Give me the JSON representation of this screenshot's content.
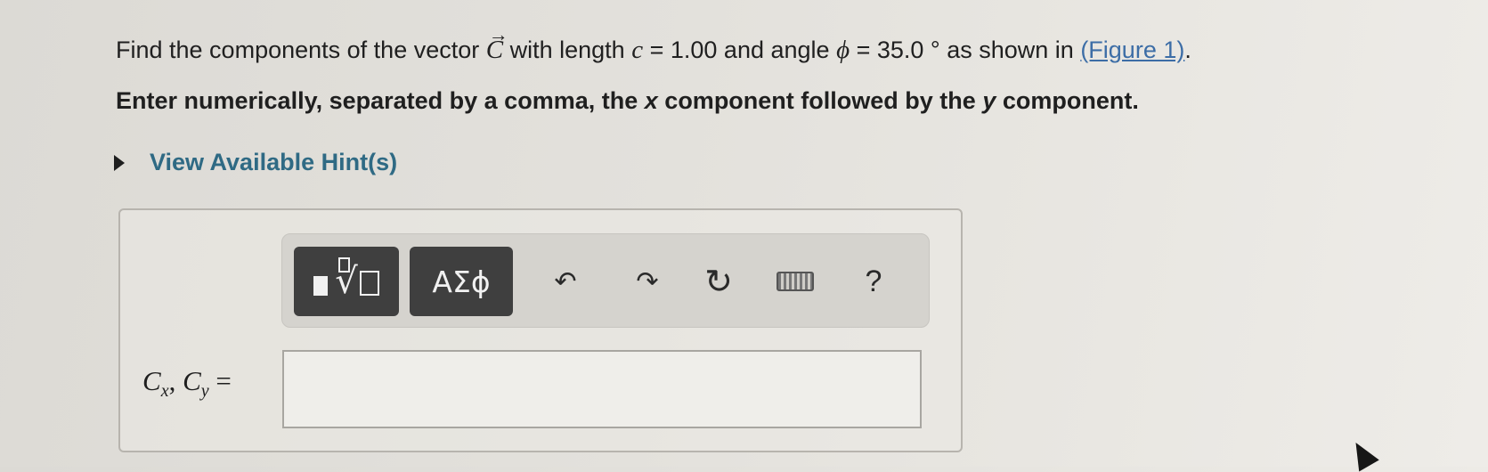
{
  "question": {
    "line1_prefix": "Find the components of the vector",
    "vector_symbol": "C",
    "vector_arrow": "→",
    "line1_mid": "with length",
    "length_var": "c",
    "length_value": "= 1.00 and angle",
    "angle_var": "ϕ",
    "angle_value": "= 35.0 °  as shown in",
    "figure_link": "(Figure 1)",
    "line1_end": ".",
    "line2_part1": "Enter numerically, separated by a comma, the",
    "line2_x": "x",
    "line2_part2": "component followed by the",
    "line2_y": "y",
    "line2_part3": "component."
  },
  "hint": {
    "label": "View Available Hint(s)"
  },
  "toolbar": {
    "greek_label": "ΑΣϕ",
    "undo_icon": "↶",
    "redo_icon": "↷",
    "reset_icon": "↻",
    "help_label": "?"
  },
  "answer": {
    "var1": "C",
    "sub1": "x",
    "var2": "C",
    "sub2": "y",
    "equals": "=",
    "value": ""
  },
  "colors": {
    "hint_color": "#2f6a84",
    "link_color": "#3c6da6",
    "toolbar_button": "#3f3f3f"
  }
}
